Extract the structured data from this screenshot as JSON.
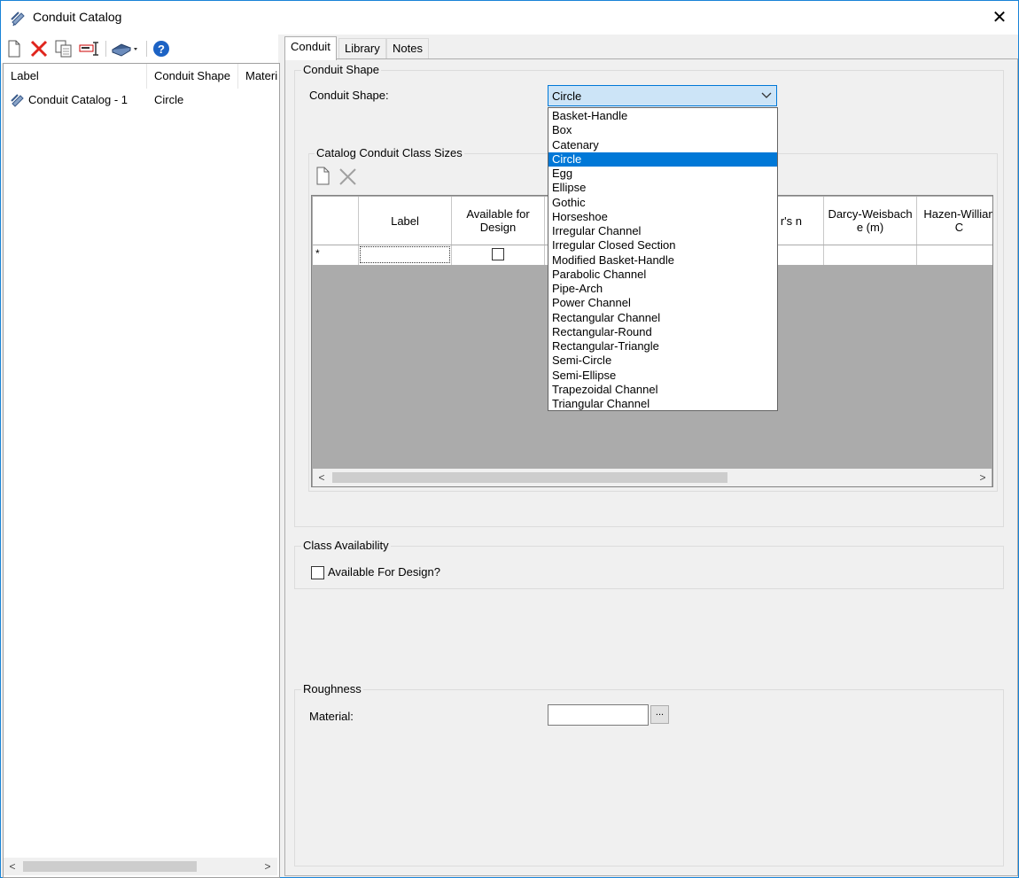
{
  "window": {
    "title": "Conduit Catalog",
    "close_glyph": "✕"
  },
  "left_toolbar": {
    "icons": [
      "new-icon",
      "delete-icon",
      "copy-icon",
      "rename-icon",
      "book-icon",
      "help-icon"
    ],
    "colors": {
      "delete": "#e0251d",
      "help": "#1c62c4",
      "book": "#3f5f8f"
    }
  },
  "left_list": {
    "columns": [
      "Label",
      "Conduit Shape",
      "Materi"
    ],
    "rows": [
      {
        "label": "Conduit Catalog - 1",
        "shape": "Circle"
      }
    ]
  },
  "tabs": [
    "Conduit",
    "Library",
    "Notes"
  ],
  "conduit_shape": {
    "group_title": "Conduit Shape",
    "field_label": "Conduit Shape:",
    "selected": "Circle",
    "options": [
      "Basket-Handle",
      "Box",
      "Catenary",
      "Circle",
      "Egg",
      "Ellipse",
      "Gothic",
      "Horseshoe",
      "Irregular Channel",
      "Irregular Closed Section",
      "Modified Basket-Handle",
      "Parabolic Channel",
      "Pipe-Arch",
      "Power Channel",
      "Rectangular Channel",
      "Rectangular-Round",
      "Rectangular-Triangle",
      "Semi-Circle",
      "Semi-Ellipse",
      "Trapezoidal Channel",
      "Triangular Channel"
    ]
  },
  "class_sizes": {
    "group_title": "Catalog Conduit Class Sizes",
    "columns": [
      "Label",
      "Available for Design",
      "r's n",
      "Darcy-Weisbach e (m)",
      "Hazen-Willian C"
    ],
    "new_row_marker": "*"
  },
  "class_availability": {
    "group_title": "Class Availability",
    "checkbox_label": "Available For Design?",
    "checked": false
  },
  "roughness": {
    "group_title": "Roughness",
    "material_label": "Material:",
    "material_value": "",
    "browse_label": "..."
  },
  "accent_color": "#0078d7"
}
